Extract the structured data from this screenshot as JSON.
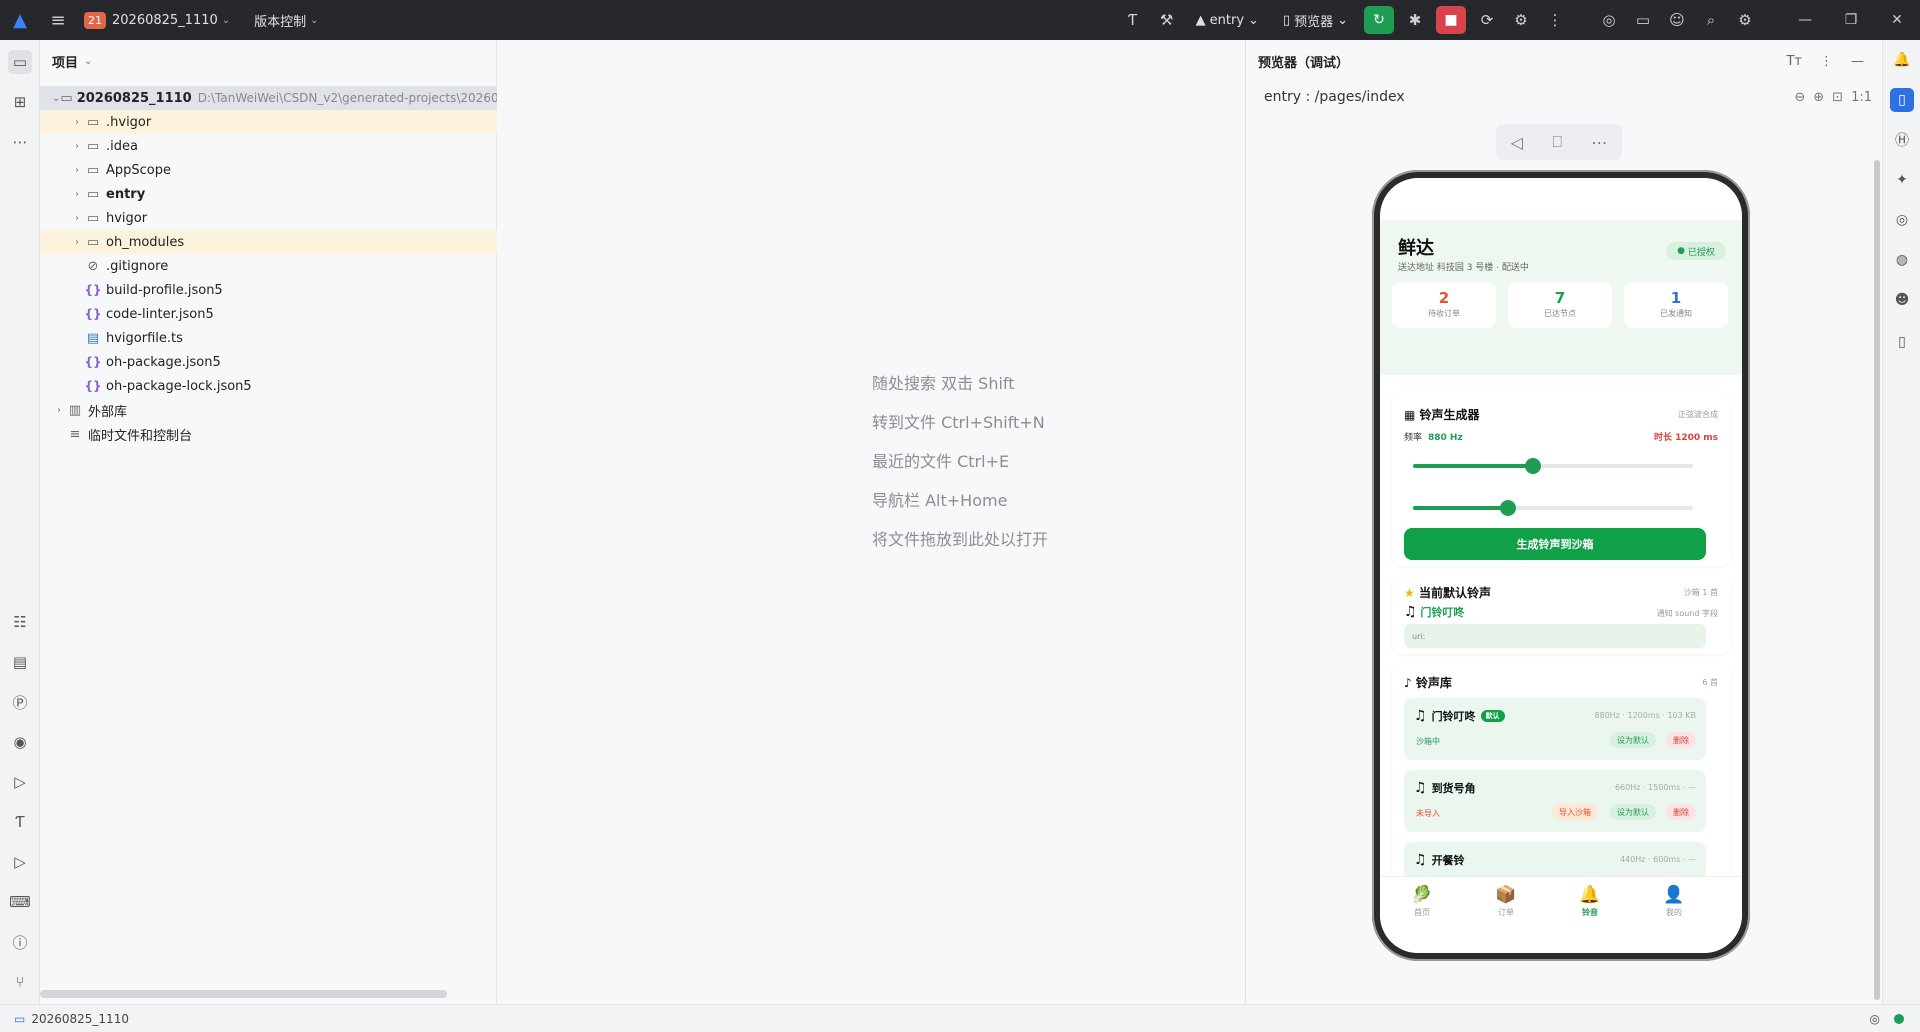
{
  "titlebar": {
    "project_badge": "21",
    "project_name": "20260825_1110",
    "vcs_label": "版本控制",
    "module_label": "entry",
    "device_label": "预览器"
  },
  "project_panel": {
    "title": "项目",
    "root_name": "20260825_1110",
    "root_path": "D:\\TanWeiWei\\CSDN_v2\\generated-projects\\2026082",
    "items": [
      {
        "label": ".hvigor",
        "type": "folder"
      },
      {
        "label": ".idea",
        "type": "folder"
      },
      {
        "label": "AppScope",
        "type": "folder"
      },
      {
        "label": "entry",
        "type": "module"
      },
      {
        "label": "hvigor",
        "type": "folder"
      },
      {
        "label": "oh_modules",
        "type": "folder"
      },
      {
        "label": ".gitignore",
        "type": "ignore"
      },
      {
        "label": "build-profile.json5",
        "type": "json"
      },
      {
        "label": "code-linter.json5",
        "type": "json"
      },
      {
        "label": "hvigorfile.ts",
        "type": "ts"
      },
      {
        "label": "oh-package.json5",
        "type": "json"
      },
      {
        "label": "oh-package-lock.json5",
        "type": "json"
      }
    ],
    "external_libs": "外部库",
    "scratch": "临时文件和控制台"
  },
  "editor": {
    "hints": [
      "随处搜索 双击 Shift",
      "转到文件 Ctrl+Shift+N",
      "最近的文件 Ctrl+E",
      "导航栏 Alt+Home",
      "将文件拖放到此处以打开"
    ]
  },
  "previewer": {
    "title": "预览器（调试）",
    "path": "entry : /pages/index",
    "zoom_label": "1:1"
  },
  "app": {
    "title": "鲜达",
    "address": "送达地址 科技园 3 号楼 · 配送中",
    "auth_badge": "已授权",
    "stats": [
      {
        "value": "2",
        "label": "待收订单",
        "color": "#e0552a"
      },
      {
        "value": "7",
        "label": "已达节点",
        "color": "#1f9d55"
      },
      {
        "value": "1",
        "label": "已发通知",
        "color": "#2f6fe4"
      }
    ],
    "generator": {
      "title": "铃声生成器",
      "note": "正弦波合成",
      "freq_label": "频率",
      "freq_value": "880 Hz",
      "duration": "时长 1200 ms",
      "freq_slider": 0.43,
      "dur_slider": 0.34,
      "button": "生成铃声到沙箱"
    },
    "current": {
      "title": "当前默认铃声",
      "note": "沙箱 1 首",
      "name": "门铃叮咚",
      "name_note": "通知 sound 字段",
      "uri_label": "uri:"
    },
    "library": {
      "title": "铃声库",
      "count": "6 首",
      "items": [
        {
          "name": "门铃叮咚",
          "is_default": true,
          "default_tag": "默认",
          "meta": "880Hz · 1200ms · 103 KB",
          "status": "沙箱中",
          "status_color": "#1f9d55",
          "actions": [
            "设为默认",
            "删除"
          ]
        },
        {
          "name": "到货号角",
          "is_default": false,
          "default_tag": "",
          "meta": "660Hz · 1500ms · —",
          "status": "未导入",
          "status_color": "#e0552a",
          "actions": [
            "导入沙箱",
            "设为默认",
            "删除"
          ]
        },
        {
          "name": "开餐铃",
          "is_default": false,
          "default_tag": "",
          "meta": "440Hz · 600ms · —",
          "status": "",
          "status_color": "#999",
          "actions": []
        }
      ]
    },
    "tabs": [
      {
        "label": "首页",
        "icon": "🥬"
      },
      {
        "label": "订单",
        "icon": "📦"
      },
      {
        "label": "铃音",
        "icon": "🔔"
      },
      {
        "label": "我的",
        "icon": "👤"
      }
    ],
    "active_tab": 2
  },
  "statusbar": {
    "project": "20260825_1110"
  }
}
